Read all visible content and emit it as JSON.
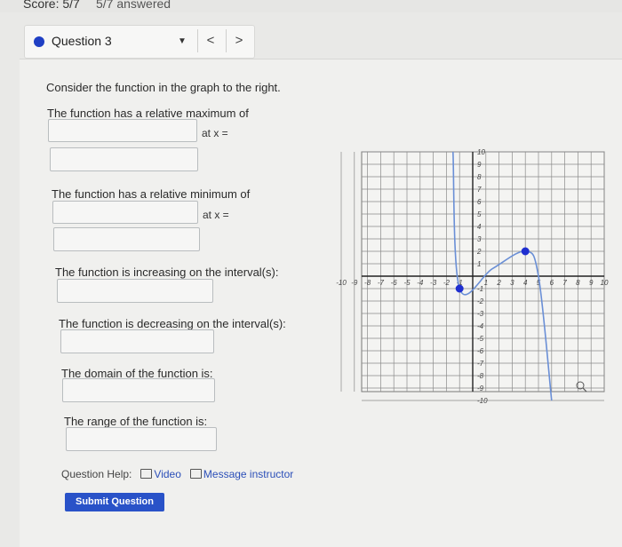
{
  "header": {
    "score": "Score: 5/7",
    "answered": "5/7 answered"
  },
  "question_nav": {
    "label": "Question 3",
    "caret": "▼",
    "prev": "<",
    "next": ">"
  },
  "question": {
    "prompt": "Consider the function in the graph to the right.",
    "rel_max_label": "The function has a relative maximum of",
    "rel_max_at": "at x =",
    "rel_min_label": "The function has a relative minimum of",
    "rel_min_at": "at x =",
    "increasing_label": "The function is increasing on the interval(s):",
    "decreasing_label": "The function is decreasing on the interval(s):",
    "domain_label": "The domain of the function is:",
    "range_label": "The range of the function is:"
  },
  "inputs": {
    "rel_max_value": "",
    "rel_max_x": "",
    "rel_min_value": "",
    "rel_min_x": "",
    "increasing": "",
    "decreasing": "",
    "domain": "",
    "range": ""
  },
  "help": {
    "label": "Question Help:",
    "video": "Video",
    "message": "Message instructor"
  },
  "submit_label": "Submit Question",
  "graph": {
    "x_ticks": [
      "-10",
      "-9",
      "-8",
      "-7",
      "-6",
      "-5",
      "-4",
      "-3",
      "-2",
      "-1",
      "1",
      "2",
      "3",
      "4",
      "5",
      "6",
      "7",
      "8",
      "9",
      "10"
    ],
    "y_ticks": [
      "10",
      "9",
      "8",
      "7",
      "6",
      "5",
      "4",
      "3",
      "2",
      "1",
      "-1",
      "-2",
      "-3",
      "-4",
      "-5",
      "-6",
      "-7",
      "-8",
      "-9",
      "-10"
    ],
    "curve_color": "#6a8fd6",
    "point_color": "#1f2fd0",
    "xlim": [
      -10,
      10
    ],
    "ylim": [
      -10,
      10
    ],
    "points": [
      {
        "x": -1,
        "y": -1,
        "filled": true
      },
      {
        "x": 4,
        "y": 2,
        "filled": true
      }
    ],
    "curve": [
      [
        -1.5,
        10
      ],
      [
        -1,
        -1
      ],
      [
        1.5,
        0.6
      ],
      [
        4,
        2
      ],
      [
        5,
        0
      ],
      [
        6,
        -10
      ]
    ]
  },
  "colors": {
    "accent": "#2952c8",
    "link": "#2b4fb8",
    "dot": "#1f3fc4"
  }
}
